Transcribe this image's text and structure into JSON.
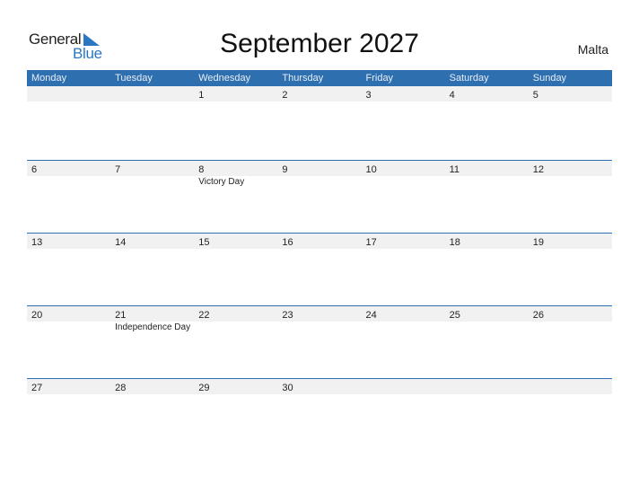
{
  "logo": {
    "word1": "General",
    "word2": "Blue"
  },
  "title": "September 2027",
  "country": "Malta",
  "colors": {
    "header_bg": "#2e6fb0",
    "band_bg": "#f1f1f1",
    "brand_blue": "#2a78c2"
  },
  "weekdays": [
    "Monday",
    "Tuesday",
    "Wednesday",
    "Thursday",
    "Friday",
    "Saturday",
    "Sunday"
  ],
  "weeks": [
    {
      "days": [
        {
          "n": "",
          "h": ""
        },
        {
          "n": "",
          "h": ""
        },
        {
          "n": "1",
          "h": ""
        },
        {
          "n": "2",
          "h": ""
        },
        {
          "n": "3",
          "h": ""
        },
        {
          "n": "4",
          "h": ""
        },
        {
          "n": "5",
          "h": ""
        }
      ]
    },
    {
      "days": [
        {
          "n": "6",
          "h": ""
        },
        {
          "n": "7",
          "h": ""
        },
        {
          "n": "8",
          "h": "Victory Day"
        },
        {
          "n": "9",
          "h": ""
        },
        {
          "n": "10",
          "h": ""
        },
        {
          "n": "11",
          "h": ""
        },
        {
          "n": "12",
          "h": ""
        }
      ]
    },
    {
      "days": [
        {
          "n": "13",
          "h": ""
        },
        {
          "n": "14",
          "h": ""
        },
        {
          "n": "15",
          "h": ""
        },
        {
          "n": "16",
          "h": ""
        },
        {
          "n": "17",
          "h": ""
        },
        {
          "n": "18",
          "h": ""
        },
        {
          "n": "19",
          "h": ""
        }
      ]
    },
    {
      "days": [
        {
          "n": "20",
          "h": ""
        },
        {
          "n": "21",
          "h": "Independence Day"
        },
        {
          "n": "22",
          "h": ""
        },
        {
          "n": "23",
          "h": ""
        },
        {
          "n": "24",
          "h": ""
        },
        {
          "n": "25",
          "h": ""
        },
        {
          "n": "26",
          "h": ""
        }
      ]
    },
    {
      "days": [
        {
          "n": "27",
          "h": ""
        },
        {
          "n": "28",
          "h": ""
        },
        {
          "n": "29",
          "h": ""
        },
        {
          "n": "30",
          "h": ""
        },
        {
          "n": "",
          "h": ""
        },
        {
          "n": "",
          "h": ""
        },
        {
          "n": "",
          "h": ""
        }
      ]
    }
  ]
}
